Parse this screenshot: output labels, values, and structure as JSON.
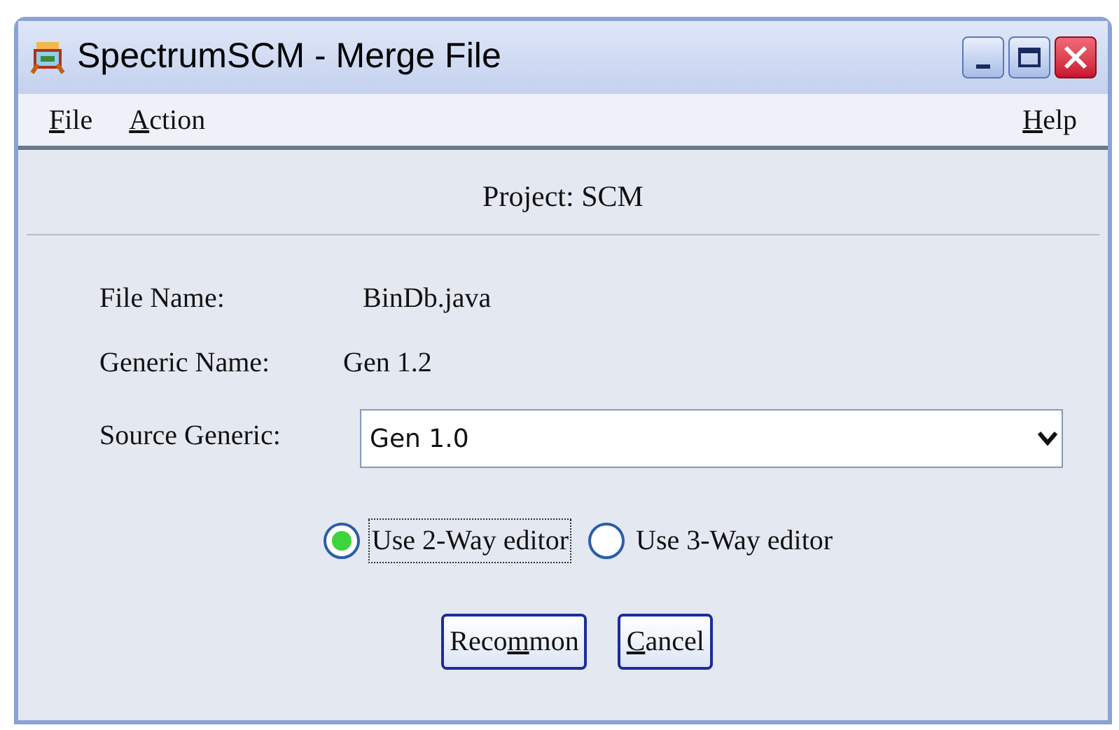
{
  "window": {
    "title": "SpectrumSCM - Merge File"
  },
  "menu": [
    {
      "key": "F",
      "after": "ile"
    },
    {
      "key": "A",
      "after": "ction"
    },
    {
      "key": "H",
      "after": "elp"
    }
  ],
  "project": "Project: SCM",
  "fields": [
    {
      "kind": "text",
      "label": "File Name:",
      "value": "BinDb.java"
    },
    {
      "kind": "text",
      "label": "Generic Name:",
      "value": "Gen 1.2"
    },
    {
      "kind": "combo",
      "label": "Source Generic:",
      "value": "Gen 1.0"
    }
  ],
  "editor_options": [
    {
      "label": "Use 2-Way editor",
      "selected": true,
      "focused": true
    },
    {
      "label": "Use 3-Way editor",
      "selected": false,
      "focused": false
    }
  ],
  "buttons": [
    {
      "before": "Reco",
      "key": "m",
      "after": "mon"
    },
    {
      "key": "C",
      "after": "ancel"
    }
  ]
}
